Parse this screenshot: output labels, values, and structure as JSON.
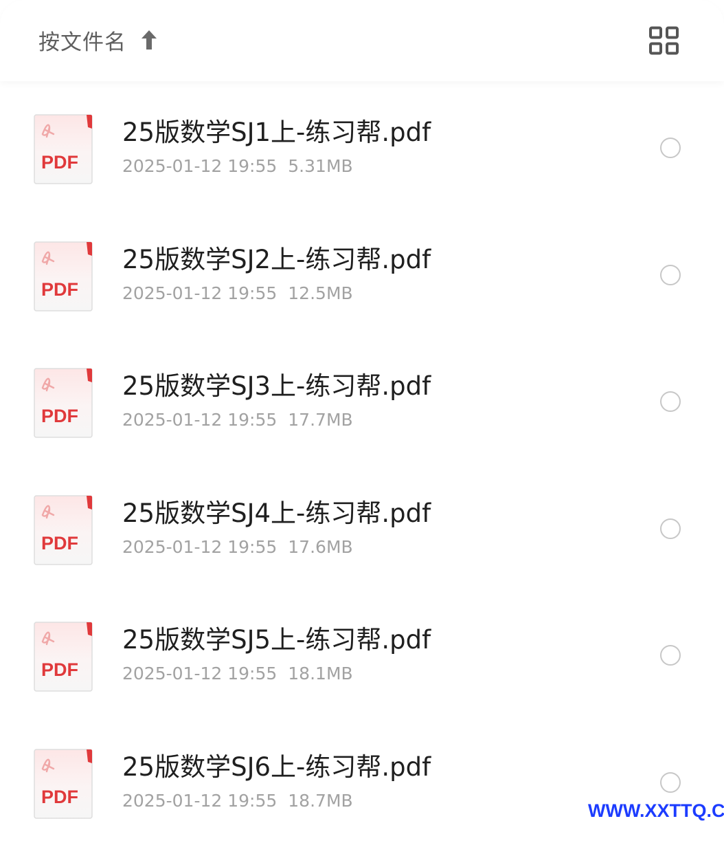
{
  "header": {
    "sort_label": "按文件名",
    "sort_icon": "arrow-up-icon",
    "view_toggle_icon": "grid-view-icon"
  },
  "colors": {
    "pdf_red": "#e0393b",
    "text_primary": "#1f1f1f",
    "text_secondary": "#a2a2a2",
    "watermark": "#1c3cff"
  },
  "files": [
    {
      "name": "25版数学SJ1上-练习帮.pdf",
      "date": "2025-01-12 19:55",
      "size": "5.31MB",
      "icon": "pdf-file-icon",
      "badge": "PDF"
    },
    {
      "name": "25版数学SJ2上-练习帮.pdf",
      "date": "2025-01-12 19:55",
      "size": "12.5MB",
      "icon": "pdf-file-icon",
      "badge": "PDF"
    },
    {
      "name": "25版数学SJ3上-练习帮.pdf",
      "date": "2025-01-12 19:55",
      "size": "17.7MB",
      "icon": "pdf-file-icon",
      "badge": "PDF"
    },
    {
      "name": "25版数学SJ4上-练习帮.pdf",
      "date": "2025-01-12 19:55",
      "size": "17.6MB",
      "icon": "pdf-file-icon",
      "badge": "PDF"
    },
    {
      "name": "25版数学SJ5上-练习帮.pdf",
      "date": "2025-01-12 19:55",
      "size": "18.1MB",
      "icon": "pdf-file-icon",
      "badge": "PDF"
    },
    {
      "name": "25版数学SJ6上-练习帮.pdf",
      "date": "2025-01-12 19:55",
      "size": "18.7MB",
      "icon": "pdf-file-icon",
      "badge": "PDF"
    }
  ],
  "watermark": "WWW.XXTTQ.COM"
}
